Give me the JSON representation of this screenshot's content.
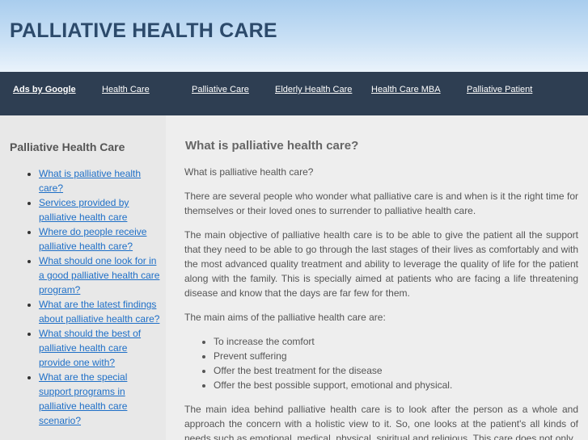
{
  "site": {
    "title": "PALLIATIVE HEALTH CARE"
  },
  "nav": {
    "ads_label": "Ads by Google",
    "links": [
      "Health Care",
      "Palliative Care",
      "Elderly Health Care",
      "Health Care MBA",
      "Palliative Patient"
    ]
  },
  "sidebar": {
    "title": "Palliative Health Care",
    "links": [
      "What is palliative health care?",
      "Services provided by palliative health care",
      "Where do people receive palliative health care?",
      "What should one look for in a good palliative health care program?",
      "What are the latest findings about palliative health care?",
      "What should the best of palliative health care provide one with?",
      "What are the special support programs in palliative health care scenario?"
    ]
  },
  "main": {
    "heading": "What is palliative health care?",
    "intro": "What is palliative health care?",
    "p1": "There are several people who wonder what palliative care is and when is it the right time for themselves or their loved ones to surrender to palliative health care.",
    "p2": "The main objective of palliative health care is to be able to give the patient all the support that they need to be able to go through the last stages of their lives as comfortably and with the most advanced quality treatment and ability to leverage the quality of life for the patient along with the family. This is specially aimed at patients who are facing a life threatening disease and know that the days are far few for them.",
    "p3": "The main aims of the palliative health care are:",
    "aims": [
      "To increase the comfort",
      "Prevent suffering",
      "Offer the best treatment for the disease",
      "Offer the best possible support, emotional and physical."
    ],
    "p4": "The main idea behind palliative health care is to look after the person as a whole and approach the concern with a holistic view to it. So, one looks at the patient's all kinds of needs such as emotional, medical, physical, spiritual and religious. This care does not only"
  }
}
